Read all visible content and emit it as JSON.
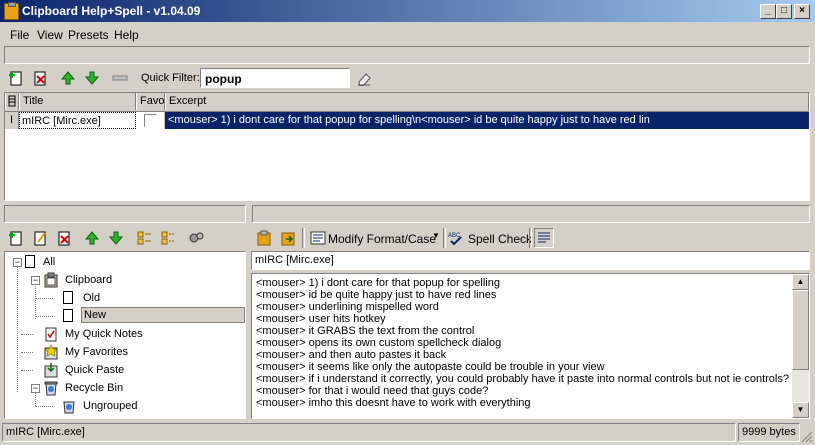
{
  "window": {
    "title": "Clipboard Help+Spell - v1.04.09",
    "minimize": "_",
    "maximize": "□",
    "close": "×"
  },
  "menu": {
    "file": "File",
    "view": "View",
    "presets": "Presets",
    "help": "Help"
  },
  "filter": {
    "label": "Quick Filter:",
    "value": "popup"
  },
  "grid": {
    "columns": [
      "Title",
      "Favo",
      "Excerpt"
    ],
    "rows": [
      {
        "marker": "I",
        "title": "mIRC [Mirc.exe]",
        "excerpt": "<mouser> 1) i dont care for that popup for spelling\\n<mouser> id be quite happy just to have red lin"
      }
    ]
  },
  "toolbar2": {
    "modify": "Modify Format/Case",
    "spell": "Spell Check"
  },
  "tree": {
    "all": "All",
    "clipboard": "Clipboard",
    "old": "Old",
    "new": "New",
    "notes": "My Quick Notes",
    "favorites": "My Favorites",
    "paste": "Quick Paste",
    "recycle": "Recycle Bin",
    "ungrouped": "Ungrouped"
  },
  "editor": {
    "title_value": "mIRC [Mirc.exe]",
    "lines": [
      "<mouser> 1) i dont care for that popup for spelling",
      "<mouser> id be quite happy just to have red lines",
      "<mouser> underlining mispelled word",
      "<mouser> user hits hotkey",
      "<mouser> it GRABS the text from the control",
      "<mouser> opens its own custom spellcheck dialog",
      "<mouser> and then auto pastes it back",
      "<mouser> it seems like only the autopaste could be trouble in your view",
      "<mouser> if i understand it correctly, you could probably have it paste into normal controls but not ie controls?",
      "<mouser> for that i would need that guys code?",
      "<mouser> imho this doesnt have to work with everything"
    ]
  },
  "status": {
    "left": "mIRC [Mirc.exe]",
    "right": "9999 bytes"
  },
  "colors": {
    "title_start": "#0a246a",
    "title_end": "#a6caf0",
    "selection": "#0a246a",
    "face": "#d4d0c8"
  }
}
